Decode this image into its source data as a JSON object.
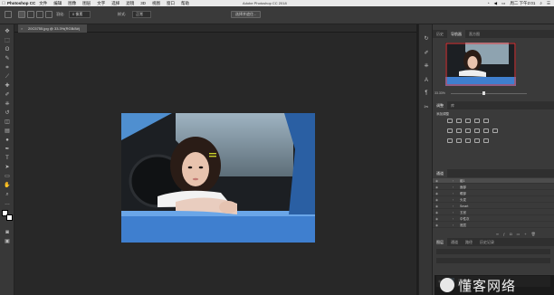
{
  "menubar": {
    "app_name": "Photoshop CC",
    "items": [
      "文件",
      "编辑",
      "图像",
      "图层",
      "文字",
      "选择",
      "滤镜",
      "3D",
      "视图",
      "窗口",
      "帮助"
    ],
    "window_title": "Adobe Photoshop CC 2018",
    "clock": "周二 下午2:01"
  },
  "options_bar": {
    "label_feather": "羽化:",
    "feather_value": "0 像素",
    "style_label": "样式:",
    "style_value": "正常",
    "select_mask_button": "选择并遮住..."
  },
  "document": {
    "tab_title": "20C5755.jpg @ 33.3%(RGB/8#)"
  },
  "navigator": {
    "tabs": [
      "历史",
      "导航器",
      "直方图"
    ],
    "zoom": "33.33%"
  },
  "adjustments": {
    "tabs": [
      "调整",
      "库"
    ],
    "title": "添加调整"
  },
  "layers": {
    "header_tabs": [
      "通道"
    ],
    "items": [
      {
        "label": "组1"
      },
      {
        "label": "面部"
      },
      {
        "label": "眼部"
      },
      {
        "label": "头发"
      },
      {
        "label": "Smart"
      },
      {
        "label": "五官"
      },
      {
        "label": "中性灰"
      },
      {
        "label": "底层"
      }
    ]
  },
  "bottom_panel": {
    "tabs": [
      "图层",
      "通道",
      "路径",
      "历史记录"
    ],
    "layer_name": "背景"
  },
  "watermark": {
    "text": "懂客网络"
  }
}
